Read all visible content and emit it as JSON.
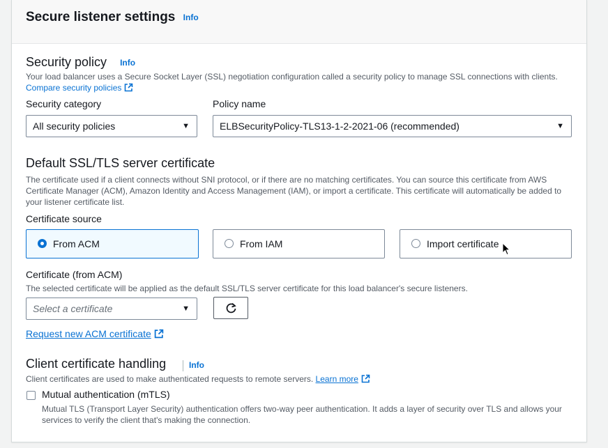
{
  "header": {
    "title": "Secure listener settings",
    "info": "Info"
  },
  "security_policy": {
    "title": "Security policy",
    "info": "Info",
    "description": "Your load balancer uses a Secure Socket Layer (SSL) negotiation configuration called a security policy to manage SSL connections with clients.",
    "compare_link": "Compare security policies",
    "category_label": "Security category",
    "category_value": "All security policies",
    "policy_label": "Policy name",
    "policy_value": "ELBSecurityPolicy-TLS13-1-2-2021-06 (recommended)"
  },
  "default_cert": {
    "title": "Default SSL/TLS server certificate",
    "description": "The certificate used if a client connects without SNI protocol, or if there are no matching certificates. You can source this certificate from AWS Certificate Manager (ACM), Amazon Identity and Access Management (IAM), or import a certificate. This certificate will automatically be added to your listener certificate list.",
    "source_label": "Certificate source",
    "sources": [
      {
        "label": "From ACM",
        "selected": true
      },
      {
        "label": "From IAM",
        "selected": false
      },
      {
        "label": "Import certificate",
        "selected": false
      }
    ],
    "cert_label": "Certificate (from ACM)",
    "cert_description": "The selected certificate will be applied as the default SSL/TLS server certificate for this load balancer's secure listeners.",
    "cert_placeholder": "Select a certificate",
    "request_link": "Request new ACM certificate"
  },
  "client_cert": {
    "title": "Client certificate handling",
    "info": "Info",
    "description": "Client certificates are used to make authenticated requests to remote servers.",
    "learn_more": "Learn more",
    "mtls_label": "Mutual authentication (mTLS)",
    "mtls_checked": false,
    "mtls_description": "Mutual TLS (Transport Layer Security) authentication offers two-way peer authentication. It adds a layer of security over TLS and allows your services to verify the client that's making the connection."
  },
  "colors": {
    "accent": "#0972d3",
    "text": "#16191f",
    "secondary_text": "#545b64",
    "border": "#7d8998"
  },
  "icons": [
    "external-link-icon",
    "caret-down-icon",
    "refresh-icon",
    "cursor-icon"
  ]
}
